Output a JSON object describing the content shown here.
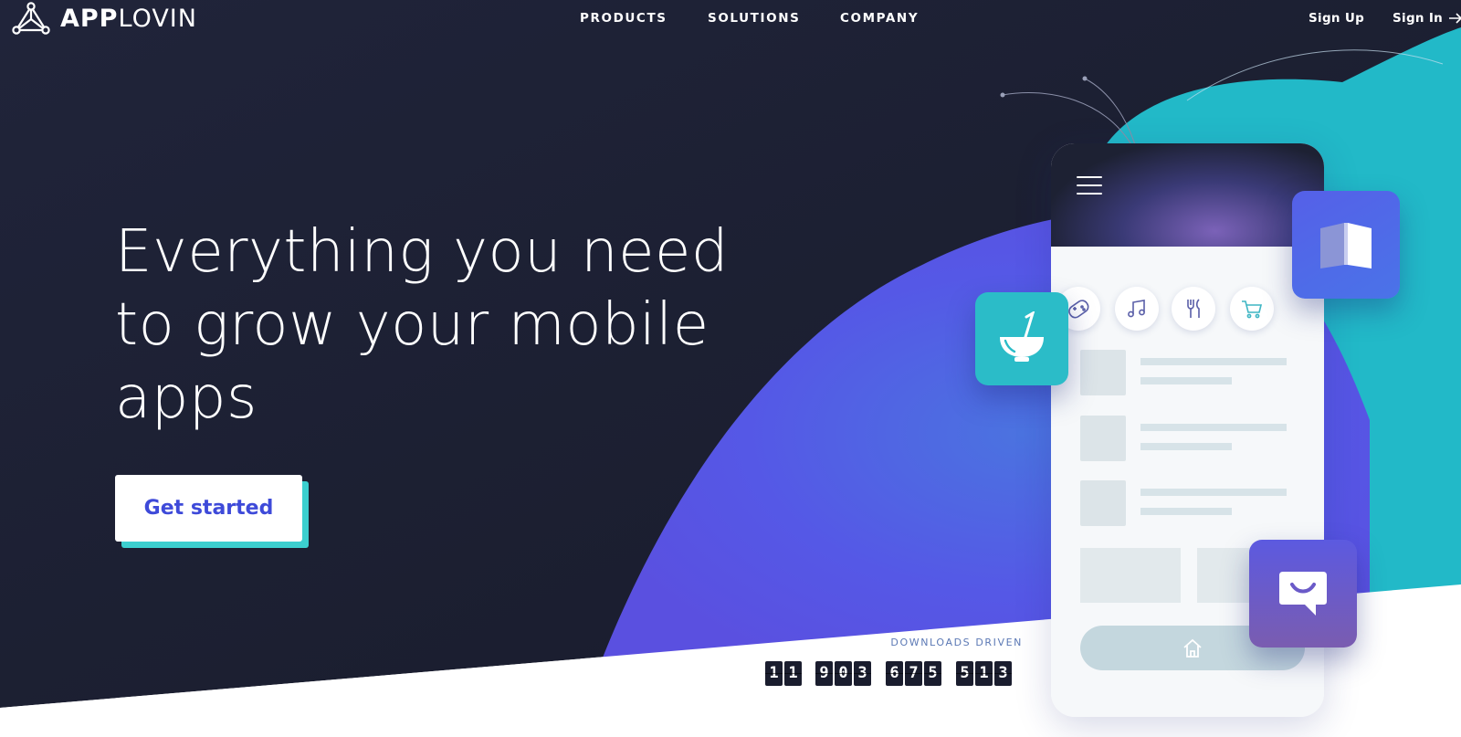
{
  "brand": {
    "logo_bold": "APP",
    "logo_light": "LOVIN",
    "icon": "applovin-triangle-icon"
  },
  "nav": {
    "products": "PRODUCTS",
    "solutions": "SOLUTIONS",
    "company": "COMPANY",
    "sign_up": "Sign Up",
    "sign_in": "Sign In",
    "sign_in_icon": "arrow-right-icon"
  },
  "hero": {
    "headline_lines": [
      "Everything you need",
      "to grow your mobile",
      "apps"
    ],
    "cta_label": "Get started"
  },
  "downloads": {
    "label": "DOWNLOADS DRIVEN",
    "value": "11903675513",
    "digits": [
      "1",
      "1",
      "9",
      "0",
      "3",
      "6",
      "7",
      "5",
      "5",
      "1",
      "3"
    ]
  },
  "phone": {
    "categories": [
      "gamepad-icon",
      "music-icon",
      "fork-knife-icon",
      "cart-icon"
    ],
    "bottom_icon": "home-icon"
  },
  "floating_tiles": [
    "food-bowl-icon",
    "book-icon",
    "chat-smile-icon"
  ],
  "colors": {
    "navy": "#1d2133",
    "indigo": "#5560e8",
    "teal": "#2bbcc8",
    "cta_text": "#3e4ad9"
  }
}
